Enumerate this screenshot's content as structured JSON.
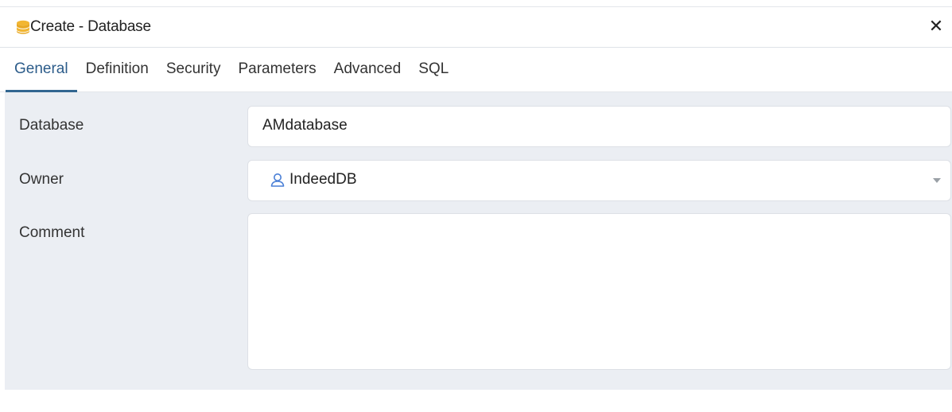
{
  "dialog": {
    "title": "Create - Database",
    "close_symbol": "✕",
    "icons": {
      "title": "database-icon",
      "close": "close-icon",
      "owner": "user-icon",
      "dropdown": "chevron-down-icon"
    },
    "accent_color": "#326690"
  },
  "tabs": [
    {
      "label": "General",
      "active": true
    },
    {
      "label": "Definition",
      "active": false
    },
    {
      "label": "Security",
      "active": false
    },
    {
      "label": "Parameters",
      "active": false
    },
    {
      "label": "Advanced",
      "active": false
    },
    {
      "label": "SQL",
      "active": false
    }
  ],
  "form": {
    "database": {
      "label": "Database",
      "value": "AMdatabase"
    },
    "owner": {
      "label": "Owner",
      "value": "IndeedDB"
    },
    "comment": {
      "label": "Comment",
      "value": ""
    }
  }
}
